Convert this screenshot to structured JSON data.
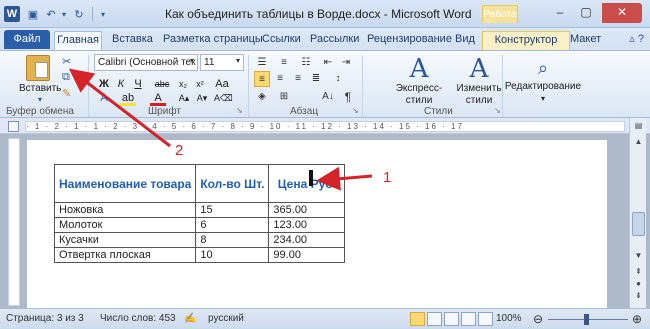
{
  "window": {
    "title": "Как объединить таблицы в Ворде.docx - Microsoft Word",
    "context_group_label": "Работа",
    "controls": {
      "minimize": "–",
      "maximize": "▢",
      "close": "✕"
    }
  },
  "tabs": [
    {
      "label": "Файл"
    },
    {
      "label": "Главная"
    },
    {
      "label": "Вставка"
    },
    {
      "label": "Разметка страницы"
    },
    {
      "label": "Ссылки"
    },
    {
      "label": "Рассылки"
    },
    {
      "label": "Рецензирование"
    },
    {
      "label": "Вид"
    },
    {
      "label": "Конструктор"
    },
    {
      "label": "Макет"
    }
  ],
  "ribbon": {
    "clipboard": {
      "paste_label": "Вставить",
      "group_label": "Буфер обмена"
    },
    "font": {
      "font_name": "Calibri (Основной тек",
      "font_size": "11",
      "group_label": "Шрифт"
    },
    "paragraph": {
      "group_label": "Абзац"
    },
    "styles": {
      "express_label": "Экспресс-стили",
      "change_label": "Изменить стили",
      "group_label": "Стили"
    },
    "editing": {
      "label": "Редактирование"
    }
  },
  "ruler_text": "· 1 · 2 · 1 · 1 · 2 · 3 · 4 · 5 · 6 · 7 · 8 · 9 · 10 · 11 · 12 · 13 · 14 · 15 · 16 · 17",
  "table": {
    "headers": [
      "Наименование товара",
      "Кол-во Шт.",
      "Цена Руб."
    ],
    "rows": [
      [
        "Ножовка",
        "15",
        "365.00"
      ],
      [
        "Молоток",
        "6",
        "123.00"
      ],
      [
        "Кусачки",
        "8",
        "234.00"
      ],
      [
        "Отвертка плоская",
        "10",
        "99.00"
      ]
    ]
  },
  "statusbar": {
    "page": "Страница: 3 из 3",
    "words": "Число слов: 453",
    "language": "русский",
    "zoom": "100%",
    "zoom_level": 1.0
  },
  "annotations": {
    "label_1": "1",
    "label_2": "2",
    "color": "#d5232a"
  }
}
